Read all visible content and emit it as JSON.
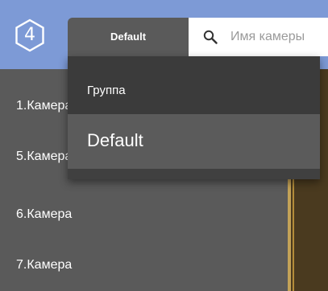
{
  "header": {
    "logo_digit": "4",
    "group_selector_label": "Default",
    "search": {
      "placeholder": "Имя камеры",
      "value": ""
    }
  },
  "sidebar": {
    "cameras": [
      {
        "label": "1.Камера"
      },
      {
        "label": "5.Камера"
      },
      {
        "label": "6.Камера"
      },
      {
        "label": "7.Камера"
      }
    ]
  },
  "group_dropdown": {
    "header_label": "Группа",
    "options": [
      {
        "label": "Default",
        "selected": true
      }
    ]
  },
  "colors": {
    "topbar": "#7d9ad6",
    "panel": "#5a5a5a",
    "dropdown_bg": "#404040",
    "dropdown_selected": "#5b5b5b",
    "accent": "#c3a257"
  }
}
